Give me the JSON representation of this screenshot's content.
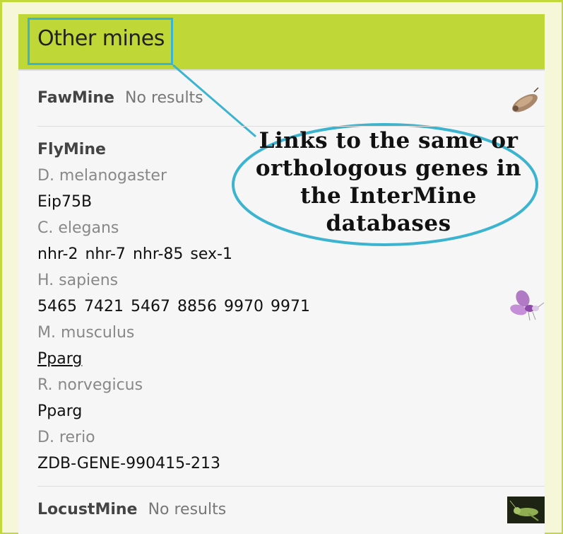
{
  "panel": {
    "title": "Other mines"
  },
  "callout": {
    "text_lines": [
      "Links to the same or",
      "orthologous genes in",
      "the InterMine",
      "databases"
    ],
    "border_color": "#3db4cf"
  },
  "colors": {
    "header_bg": "#bfd737",
    "frame_border": "#c3d83a",
    "panel_bg": "#f6f6f6"
  },
  "mines": [
    {
      "name": "FawMine",
      "status": "No results",
      "logo_icon": "moth-icon"
    },
    {
      "name": "FlyMine",
      "logo_icon": "flymine-logo-icon",
      "groups": [
        {
          "organism": "D. melanogaster",
          "genes": [
            "Eip75B"
          ]
        },
        {
          "organism": "C. elegans",
          "genes": [
            "nhr-2",
            "nhr-7",
            "nhr-85",
            "sex-1"
          ]
        },
        {
          "organism": "H. sapiens",
          "genes": [
            "5465",
            "7421",
            "5467",
            "8856",
            "9970",
            "9971"
          ]
        },
        {
          "organism": "M. musculus",
          "genes": [
            "Pparg"
          ]
        },
        {
          "organism": "R. norvegicus",
          "genes": [
            "Pparg"
          ]
        },
        {
          "organism": "D. rerio",
          "genes": [
            "ZDB-GENE-990415-213"
          ]
        }
      ]
    },
    {
      "name": "LocustMine",
      "status": "No results",
      "logo_icon": "locust-icon"
    }
  ]
}
